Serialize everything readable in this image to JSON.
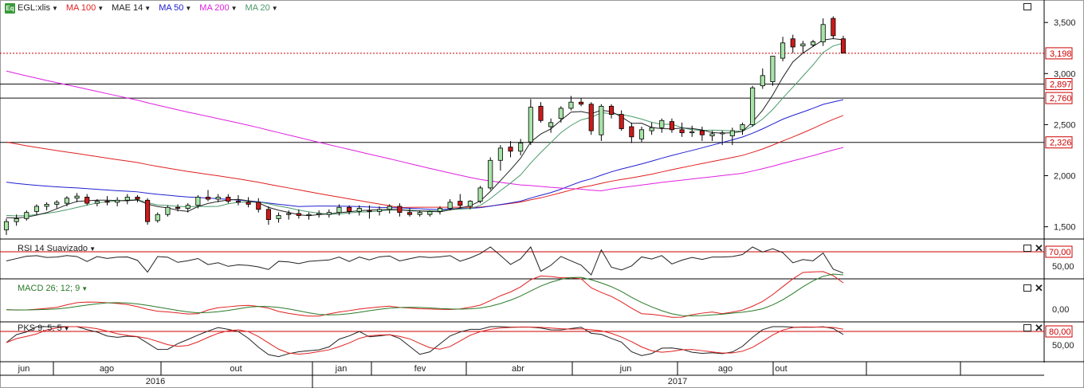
{
  "symbol": "EGL:xlis",
  "indicators": [
    {
      "label": "MA 100",
      "color": "#e02020"
    },
    {
      "label": "MAE 14",
      "color": "#222222"
    },
    {
      "label": "MA 50",
      "color": "#2020d0"
    },
    {
      "label": "MA 200",
      "color": "#e020e0"
    },
    {
      "label": "MA 20",
      "color": "#4a9a6a"
    }
  ],
  "chart_data": {
    "type": "candlestick",
    "ylim": [
      1.38,
      3.72
    ],
    "yticks": [
      1.5,
      2.0,
      2.5,
      3.0,
      3.5
    ],
    "ytick_labels": [
      "1,500",
      "2,000",
      "2,500",
      "3,000",
      "3,500"
    ],
    "price_lines": [
      {
        "value": 3.198,
        "label": "3,198",
        "color": "#cc0000",
        "dashed": true
      },
      {
        "value": 2.897,
        "label": "2,897",
        "color": "#cc0000",
        "dashed": false
      },
      {
        "value": 2.76,
        "label": "2,760",
        "color": "#cc0000",
        "dashed": false
      },
      {
        "value": 2.326,
        "label": "2,326",
        "color": "#cc0000",
        "dashed": false
      }
    ],
    "candles": [
      [
        1.47,
        1.58,
        1.42,
        1.55
      ],
      [
        1.55,
        1.62,
        1.51,
        1.58
      ],
      [
        1.58,
        1.66,
        1.56,
        1.64
      ],
      [
        1.65,
        1.72,
        1.62,
        1.7
      ],
      [
        1.7,
        1.74,
        1.66,
        1.72
      ],
      [
        1.72,
        1.76,
        1.68,
        1.74
      ],
      [
        1.73,
        1.8,
        1.7,
        1.78
      ],
      [
        1.78,
        1.83,
        1.74,
        1.8
      ],
      [
        1.79,
        1.82,
        1.71,
        1.73
      ],
      [
        1.73,
        1.77,
        1.7,
        1.75
      ],
      [
        1.75,
        1.8,
        1.71,
        1.74
      ],
      [
        1.74,
        1.79,
        1.7,
        1.76
      ],
      [
        1.76,
        1.82,
        1.72,
        1.79
      ],
      [
        1.79,
        1.81,
        1.74,
        1.77
      ],
      [
        1.76,
        1.78,
        1.52,
        1.55
      ],
      [
        1.56,
        1.64,
        1.54,
        1.62
      ],
      [
        1.62,
        1.71,
        1.6,
        1.69
      ],
      [
        1.69,
        1.72,
        1.65,
        1.68
      ],
      [
        1.68,
        1.73,
        1.64,
        1.71
      ],
      [
        1.71,
        1.81,
        1.68,
        1.79
      ],
      [
        1.79,
        1.86,
        1.75,
        1.77
      ],
      [
        1.77,
        1.82,
        1.74,
        1.79
      ],
      [
        1.79,
        1.82,
        1.73,
        1.75
      ],
      [
        1.75,
        1.81,
        1.71,
        1.74
      ],
      [
        1.74,
        1.79,
        1.69,
        1.72
      ],
      [
        1.74,
        1.78,
        1.64,
        1.67
      ],
      [
        1.67,
        1.7,
        1.52,
        1.57
      ],
      [
        1.58,
        1.64,
        1.54,
        1.61
      ],
      [
        1.62,
        1.66,
        1.57,
        1.63
      ],
      [
        1.63,
        1.67,
        1.58,
        1.61
      ],
      [
        1.61,
        1.64,
        1.57,
        1.62
      ],
      [
        1.62,
        1.66,
        1.59,
        1.63
      ],
      [
        1.62,
        1.67,
        1.59,
        1.64
      ],
      [
        1.64,
        1.72,
        1.61,
        1.69
      ],
      [
        1.69,
        1.71,
        1.62,
        1.65
      ],
      [
        1.65,
        1.71,
        1.61,
        1.68
      ],
      [
        1.66,
        1.71,
        1.58,
        1.65
      ],
      [
        1.65,
        1.7,
        1.61,
        1.67
      ],
      [
        1.67,
        1.72,
        1.63,
        1.7
      ],
      [
        1.7,
        1.73,
        1.6,
        1.64
      ],
      [
        1.64,
        1.68,
        1.6,
        1.62
      ],
      [
        1.62,
        1.66,
        1.6,
        1.64
      ],
      [
        1.62,
        1.66,
        1.6,
        1.65
      ],
      [
        1.65,
        1.7,
        1.62,
        1.68
      ],
      [
        1.68,
        1.77,
        1.66,
        1.74
      ],
      [
        1.75,
        1.82,
        1.68,
        1.71
      ],
      [
        1.7,
        1.76,
        1.67,
        1.75
      ],
      [
        1.75,
        1.9,
        1.73,
        1.88
      ],
      [
        1.88,
        2.18,
        1.86,
        2.15
      ],
      [
        2.15,
        2.3,
        2.05,
        2.27
      ],
      [
        2.28,
        2.34,
        2.18,
        2.24
      ],
      [
        2.24,
        2.36,
        2.2,
        2.32
      ],
      [
        2.33,
        2.75,
        2.3,
        2.67
      ],
      [
        2.68,
        2.72,
        2.52,
        2.54
      ],
      [
        2.48,
        2.56,
        2.42,
        2.52
      ],
      [
        2.56,
        2.68,
        2.52,
        2.66
      ],
      [
        2.66,
        2.78,
        2.64,
        2.72
      ],
      [
        2.72,
        2.76,
        2.68,
        2.7
      ],
      [
        2.7,
        2.72,
        2.4,
        2.44
      ],
      [
        2.4,
        2.7,
        2.34,
        2.68
      ],
      [
        2.68,
        2.7,
        2.56,
        2.6
      ],
      [
        2.6,
        2.64,
        2.44,
        2.46
      ],
      [
        2.48,
        2.52,
        2.32,
        2.38
      ],
      [
        2.36,
        2.48,
        2.33,
        2.45
      ],
      [
        2.44,
        2.52,
        2.4,
        2.47
      ],
      [
        2.47,
        2.56,
        2.42,
        2.54
      ],
      [
        2.53,
        2.56,
        2.42,
        2.45
      ],
      [
        2.45,
        2.52,
        2.38,
        2.42
      ],
      [
        2.42,
        2.49,
        2.38,
        2.43
      ],
      [
        2.44,
        2.48,
        2.34,
        2.4
      ],
      [
        2.39,
        2.44,
        2.34,
        2.41
      ],
      [
        2.41,
        2.44,
        2.3,
        2.42
      ],
      [
        2.39,
        2.47,
        2.3,
        2.44
      ],
      [
        2.45,
        2.52,
        2.4,
        2.5
      ],
      [
        2.5,
        2.88,
        2.48,
        2.86
      ],
      [
        2.88,
        3.05,
        2.85,
        2.98
      ],
      [
        2.92,
        3.12,
        2.88,
        3.17
      ],
      [
        3.15,
        3.36,
        3.12,
        3.3
      ],
      [
        3.34,
        3.38,
        3.2,
        3.26
      ],
      [
        3.27,
        3.32,
        3.2,
        3.29
      ],
      [
        3.28,
        3.33,
        3.26,
        3.31
      ],
      [
        3.31,
        3.54,
        3.27,
        3.48
      ],
      [
        3.54,
        3.56,
        3.34,
        3.37
      ],
      [
        3.34,
        3.37,
        3.2,
        3.2
      ]
    ],
    "sub_panes": [
      {
        "name": "RSI 14 Suavizado",
        "level": "70,00",
        "label": "50,00"
      },
      {
        "name": "MACD 26; 12; 9",
        "label": "0,00"
      },
      {
        "name": "PKS 9; 5; 5",
        "level": "80,00",
        "label": "50,00"
      }
    ],
    "time_axis": {
      "months": [
        "jun",
        "ago",
        "out",
        "jan",
        "fev",
        "abr",
        "jun",
        "ago",
        "out"
      ],
      "years": [
        "2016",
        "2017"
      ]
    }
  },
  "colors": {
    "up": "#a8e4a8",
    "down": "#cc1a1a",
    "grid": "#000000",
    "level": "#cc0000",
    "ma100": "#e02020",
    "mae14": "#222222",
    "ma50": "#2020d0",
    "ma200": "#e020e0",
    "ma20": "#4a9a6a"
  }
}
